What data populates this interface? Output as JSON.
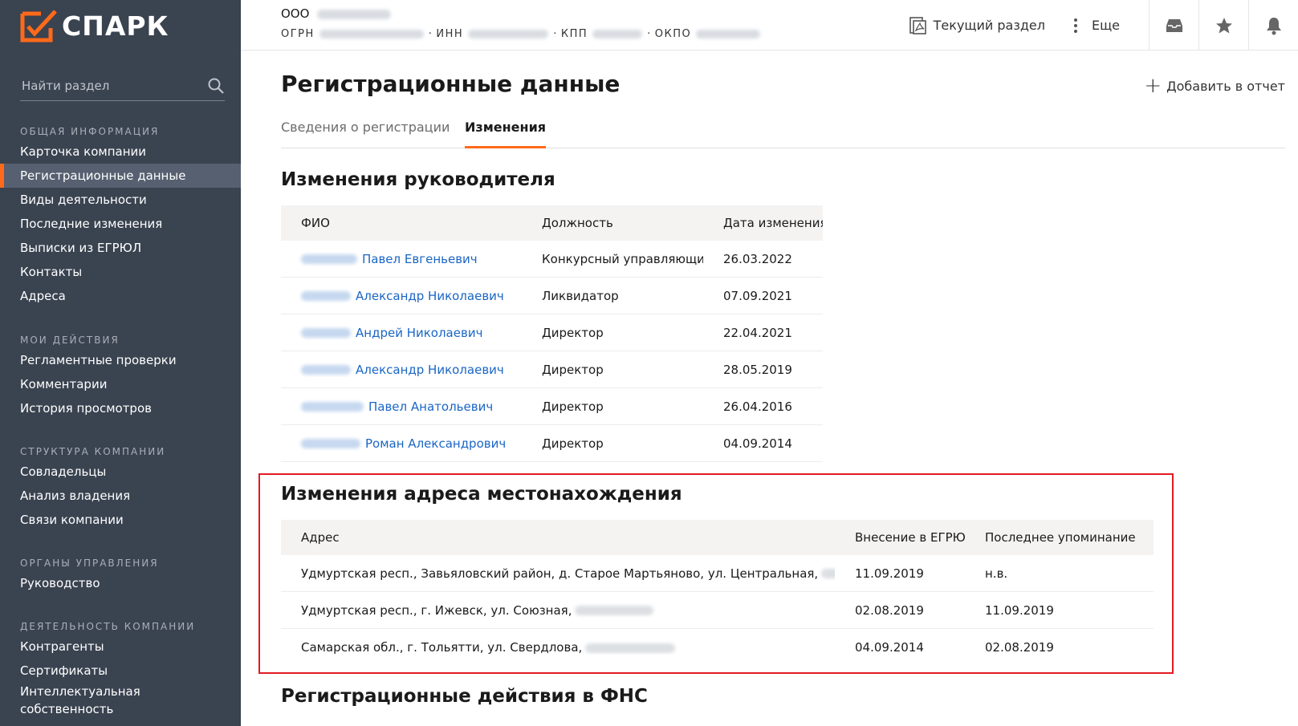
{
  "colors": {
    "sidebar_bg": "#3a4350",
    "accent": "#ff6a1a",
    "link": "#1a66c5",
    "highlight": "#e11b22"
  },
  "logo": {
    "text": "СПАРК"
  },
  "sidebar": {
    "search_placeholder": "Найти раздел",
    "sections": [
      {
        "title": "ОБЩАЯ ИНФОРМАЦИЯ",
        "items": [
          "Карточка компании",
          "Регистрационные данные",
          "Виды деятельности",
          "Последние изменения",
          "Выписки из ЕГРЮЛ",
          "Контакты",
          "Адреса"
        ]
      },
      {
        "title": "МОИ ДЕЙСТВИЯ",
        "items": [
          "Регламентные проверки",
          "Комментарии",
          "История просмотров"
        ]
      },
      {
        "title": "СТРУКТУРА КОМПАНИИ",
        "items": [
          "Совладельцы",
          "Анализ владения",
          "Связи компании"
        ]
      },
      {
        "title": "ОРГАНЫ УПРАВЛЕНИЯ",
        "items": [
          "Руководство"
        ]
      },
      {
        "title": "ДЕЯТЕЛЬНОСТЬ КОМПАНИИ",
        "items": [
          "Контрагенты",
          "Сертификаты",
          "Интеллектуальная собственность"
        ]
      }
    ],
    "active_item": "Регистрационные данные"
  },
  "header": {
    "company_prefix": "ООО",
    "ogrn_label": "ОГРН",
    "inn_label": "ИНН",
    "kpp_label": "КПП",
    "okpo_label": "ОКПО",
    "sep": "·",
    "current_section": "Текущий раздел",
    "more": "Еще"
  },
  "page": {
    "title": "Регистрационные данные",
    "add_report": "Добавить в отчет",
    "tabs": [
      "Сведения о регистрации",
      "Изменения"
    ]
  },
  "directors": {
    "title": "Изменения руководителя",
    "columns": [
      "ФИО",
      "Должность",
      "Дата изменения"
    ],
    "rows": [
      {
        "name": "Павел Евгеньевич",
        "position": "Конкурсный управляющий",
        "date": "26.03.2022"
      },
      {
        "name": "Александр Николаевич",
        "position": "Ликвидатор",
        "date": "07.09.2021"
      },
      {
        "name": "Андрей Николаевич",
        "position": "Директор",
        "date": "22.04.2021"
      },
      {
        "name": "Александр Николаевич",
        "position": "Директор",
        "date": "28.05.2019"
      },
      {
        "name": "Павел Анатольевич",
        "position": "Директор",
        "date": "26.04.2016"
      },
      {
        "name": "Роман Александрович",
        "position": "Директор",
        "date": "04.09.2014"
      }
    ]
  },
  "addresses": {
    "title": "Изменения адреса местонахождения",
    "columns": [
      "Адрес",
      "Внесение в ЕГРЮЛ",
      "Последнее упоминание"
    ],
    "rows": [
      {
        "address": "Удмуртская респ., Завьяловский район, д. Старое Мартьяново, ул. Центральная,",
        "entered": "11.09.2019",
        "last": "н.в."
      },
      {
        "address": "Удмуртская респ., г. Ижевск, ул. Союзная,",
        "entered": "02.08.2019",
        "last": "11.09.2019"
      },
      {
        "address": "Самарская обл., г. Тольятти, ул. Свердлова,",
        "entered": "04.09.2014",
        "last": "02.08.2019"
      }
    ]
  },
  "fns": {
    "title": "Регистрационные действия в ФНС"
  }
}
